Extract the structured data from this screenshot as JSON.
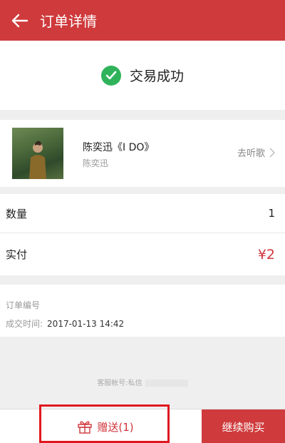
{
  "header": {
    "title": "订单详情"
  },
  "status": {
    "text": "交易成功"
  },
  "product": {
    "song": "陈奕迅《I DO》",
    "artist": "陈奕迅",
    "listen_label": "去听歌"
  },
  "order": {
    "quantity_label": "数量",
    "quantity_value": "1",
    "paid_label": "实付",
    "paid_value": "¥2",
    "order_no_label": "订单编号",
    "time_label": "成交时间:",
    "time_value": "2017-01-13 14:42"
  },
  "service": {
    "label": "客服帐号:私信"
  },
  "footer": {
    "gift_label": "赠送(1)",
    "buy_label": "继续购买"
  },
  "colors": {
    "brand": "#cf3a3c",
    "success": "#2fb35a",
    "price": "#d0353c"
  }
}
